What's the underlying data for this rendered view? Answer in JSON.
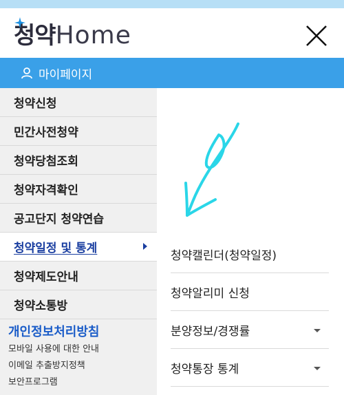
{
  "logo": {
    "korean": "청약",
    "english": "Home"
  },
  "mypage": {
    "label": "마이페이지"
  },
  "left_menu": [
    {
      "label": "청약신청"
    },
    {
      "label": "민간사전청약"
    },
    {
      "label": "청약당첨조회"
    },
    {
      "label": "청약자격확인"
    },
    {
      "label": "공고단지 청약연습"
    },
    {
      "label": "청약일정 및 통계"
    },
    {
      "label": "청약제도안내"
    },
    {
      "label": "청약소통방"
    }
  ],
  "footer": {
    "privacy": "개인정보처리방침",
    "links": [
      "모바일 사용에 대한 안내",
      "이메일 추출방지정책",
      "보안프로그램"
    ]
  },
  "sub_menu": [
    {
      "label": "청약캘린더(청약일정)"
    },
    {
      "label": "청약알리미 신청"
    },
    {
      "label": "분양정보/경쟁률"
    },
    {
      "label": "청약통장 통계"
    }
  ],
  "colors": {
    "accent": "#3aa0e8",
    "active_text": "#1a3ea0",
    "annotation": "#2ad6e8"
  }
}
